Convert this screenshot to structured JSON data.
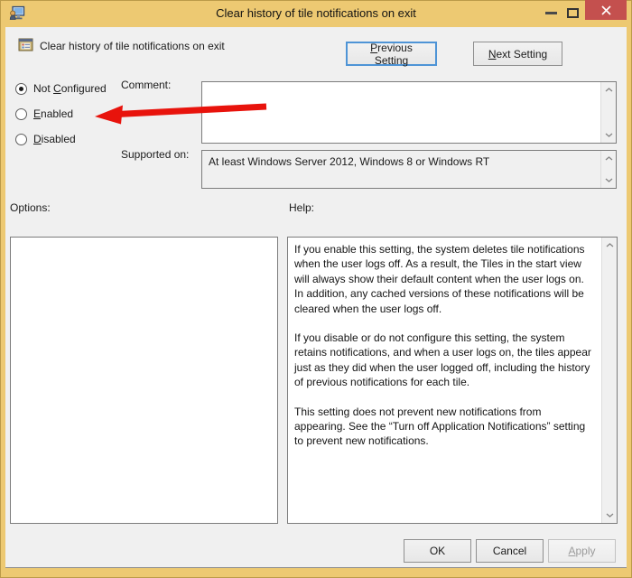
{
  "window": {
    "title": "Clear history of tile notifications on exit",
    "icons": {
      "app": "group-policy-app-icon",
      "minimize": "minimize-icon",
      "maximize": "maximize-icon",
      "close": "close-icon"
    }
  },
  "header": {
    "title": "Clear history of tile notifications on exit",
    "icon": "policy-setting-icon",
    "previous_button": {
      "pre": "",
      "accel": "P",
      "post": "revious Setting"
    },
    "next_button": {
      "pre": "",
      "accel": "N",
      "post": "ext Setting"
    }
  },
  "state_options": {
    "not_configured": {
      "pre": "Not ",
      "accel": "C",
      "post": "onfigured",
      "selected": true
    },
    "enabled": {
      "pre": "",
      "accel": "E",
      "post": "nabled",
      "selected": false
    },
    "disabled": {
      "pre": "",
      "accel": "D",
      "post": "isabled",
      "selected": false
    }
  },
  "comment": {
    "label": "Comment:",
    "value": ""
  },
  "supported_on": {
    "label": "Supported on:",
    "value": "At least Windows Server 2012, Windows 8 or Windows RT"
  },
  "options_panel": {
    "label": "Options:"
  },
  "help_panel": {
    "label": "Help:",
    "paragraphs": [
      "If you enable this setting, the system deletes tile notifications when the user logs off. As a result, the Tiles in the start view will always show their default content when the user logs on. In addition, any cached versions of these notifications will be cleared when the user logs off.",
      "If you disable or do not configure this setting, the system retains notifications, and when a user logs on, the tiles appear just as they did when the user logged off, including the history of previous notifications for each tile.",
      "This setting does not prevent new notifications from appearing. See the “Turn off Application Notifications” setting to prevent new notifications."
    ]
  },
  "footer": {
    "ok_label": "OK",
    "cancel_label": "Cancel",
    "apply_button": {
      "pre": "",
      "accel": "A",
      "post": "pply",
      "disabled": true
    }
  },
  "annotation": {
    "type": "red-arrow",
    "points_to": "Enabled option"
  },
  "colors": {
    "window_chrome": "#edc972",
    "close_button": "#c4504e",
    "dialog_background": "#f0f0f0",
    "focus_border": "#4e94d6",
    "arrow_red": "#e8130c"
  }
}
